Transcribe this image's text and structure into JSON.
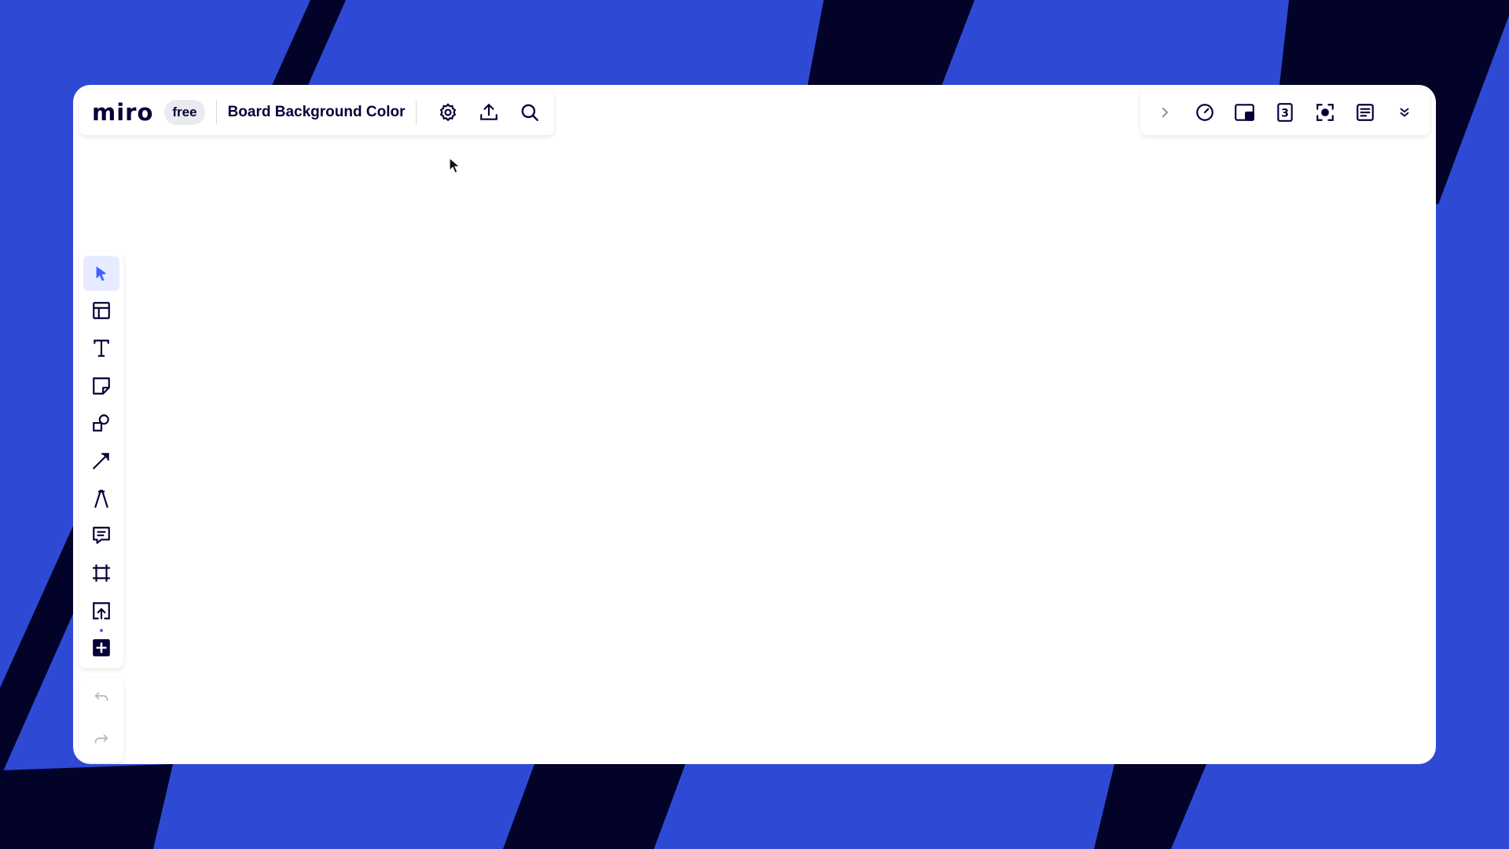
{
  "app": {
    "logo": "miro",
    "plan_badge": "free",
    "board_title": "Board Background Color"
  },
  "colors": {
    "accent": "#4262ff",
    "backdrop_blue": "#2e4ad4",
    "backdrop_navy": "#030229",
    "ink": "#050038"
  },
  "top_left_icons": [
    "settings-icon",
    "upload-icon",
    "search-icon"
  ],
  "top_right_icons": [
    "chevron-right-icon",
    "timer-icon",
    "video-icon",
    "count-icon",
    "focus-icon",
    "notes-icon",
    "chevron-double-down-icon"
  ],
  "top_right_counter": "3",
  "toolbar": {
    "tools": [
      "select-icon",
      "templates-icon",
      "text-icon",
      "sticky-note-icon",
      "shapes-icon",
      "connection-line-icon",
      "pen-icon",
      "comment-icon",
      "frame-icon",
      "upload-icon",
      "more-apps-icon"
    ],
    "active_tool": "select-icon",
    "history": [
      "undo-icon",
      "redo-icon"
    ]
  }
}
